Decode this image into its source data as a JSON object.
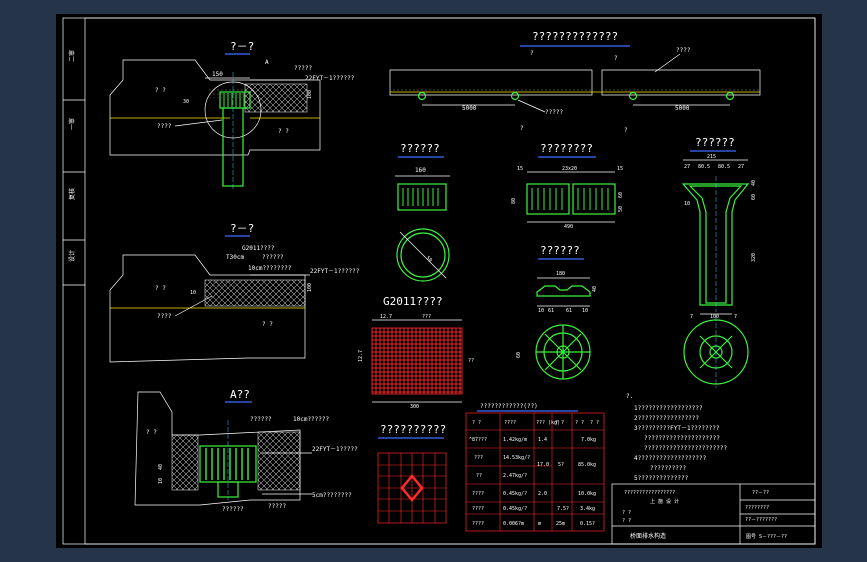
{
  "sidebar": {
    "items": [
      "二审",
      "一审",
      "复核",
      "设计"
    ]
  },
  "sections": {
    "sec1": "?－?",
    "sec2": "?－?",
    "sec3": "A??",
    "long": "?????????????",
    "circle_label": "A"
  },
  "sec1_labels": {
    "dim150": "150",
    "q1": "? ?",
    "q2": "? ?",
    "d30": "30",
    "d100": "100",
    "l1": "?????",
    "l2": "22FYT－1??????",
    "l3": "????"
  },
  "sec2_labels": {
    "g": "G2011????",
    "a": "T30cm",
    "b": "??????",
    "c": "10cm????????",
    "d": "22FYT－1??????",
    "e": "????",
    "q1": "? ?",
    "q2": "? ?",
    "d100": "100",
    "d10": "10"
  },
  "sec3_labels": {
    "a": "??????",
    "b": "10cm??????",
    "c": "22FYT－1?????",
    "d": "5cm????????",
    "e": "?????",
    "f": "??????",
    "q": "? ?",
    "d40": "40",
    "d10": "10"
  },
  "long_labels": {
    "a": "?",
    "b": "?",
    "c": "????",
    "d": "5000",
    "e": "5000",
    "f": "?????",
    "g": "?",
    "h": "?"
  },
  "parts": {
    "p1": {
      "title": "??????",
      "dim": "160",
      "dia": "50"
    },
    "p2": {
      "title": "????????",
      "d1": "15",
      "d2": "23x20",
      "d3": "15",
      "d4": "490",
      "d5": "60",
      "d6": "50",
      "d7": "80"
    },
    "p3": {
      "title": "??????",
      "d1": "180",
      "d2": "10",
      "d3": "61",
      "d4": "61",
      "d5": "40",
      "d6": "10",
      "d7": "60"
    },
    "p4": {
      "title": "??????",
      "d1": "215",
      "d2": "27",
      "d3": "80.5",
      "d4": "80.5",
      "d5": "27",
      "d6": "60",
      "d7": "10",
      "d8": "320",
      "d9": "7",
      "d10": "100",
      "d11": "7",
      "d12": "40",
      "d13": "10"
    }
  },
  "grate": {
    "title": "G2011????",
    "d1": "12.7",
    "d2": "???",
    "d3": "300",
    "d4": "12.7",
    "d5": "??"
  },
  "grid2": {
    "title": "??????????"
  },
  "table": {
    "title": "????????????(??)",
    "headers": [
      "? ?",
      "????",
      "???\n(kg)",
      "? ?",
      "? ?",
      "? ?"
    ],
    "rows": [
      [
        "^87???",
        "1.42kg/m",
        "1.4",
        "",
        "",
        "7.0kg"
      ],
      [
        "???",
        "14.53kg/?",
        "17.0",
        "5?",
        "",
        "85.0kg"
      ],
      [
        "??",
        "2.47kg/?",
        "",
        "",
        "",
        ""
      ],
      [
        "????",
        "0.45kg/?",
        "2.0",
        "",
        "",
        "10.0kg"
      ],
      [
        "????",
        "0.45kg/?",
        "",
        "",
        "7.5?",
        "3.4kg"
      ],
      [
        "????",
        "0.006?m",
        "m",
        "",
        "25m",
        "0.15?"
      ]
    ]
  },
  "notes": {
    "head": "?.",
    "lines": [
      "1??????????????????",
      "2?????????????????",
      "3?????????FYT－1????????",
      "?????????????????????",
      "???????????????????????",
      "4???????????????????",
      "??????????",
      "5??????????????"
    ]
  },
  "title_block": {
    "project": "?????????????????",
    "sub": "上  施  设  计",
    "drawing_no_label": "??－??",
    "l1": "?????",
    "l2": "??? ???",
    "l3": "?  ?",
    "l4": "?  ?",
    "drawing_name": "桥面排水构造",
    "sheet": "图号  S－???－??",
    "right1": "????????",
    "right2": "??－???????"
  }
}
